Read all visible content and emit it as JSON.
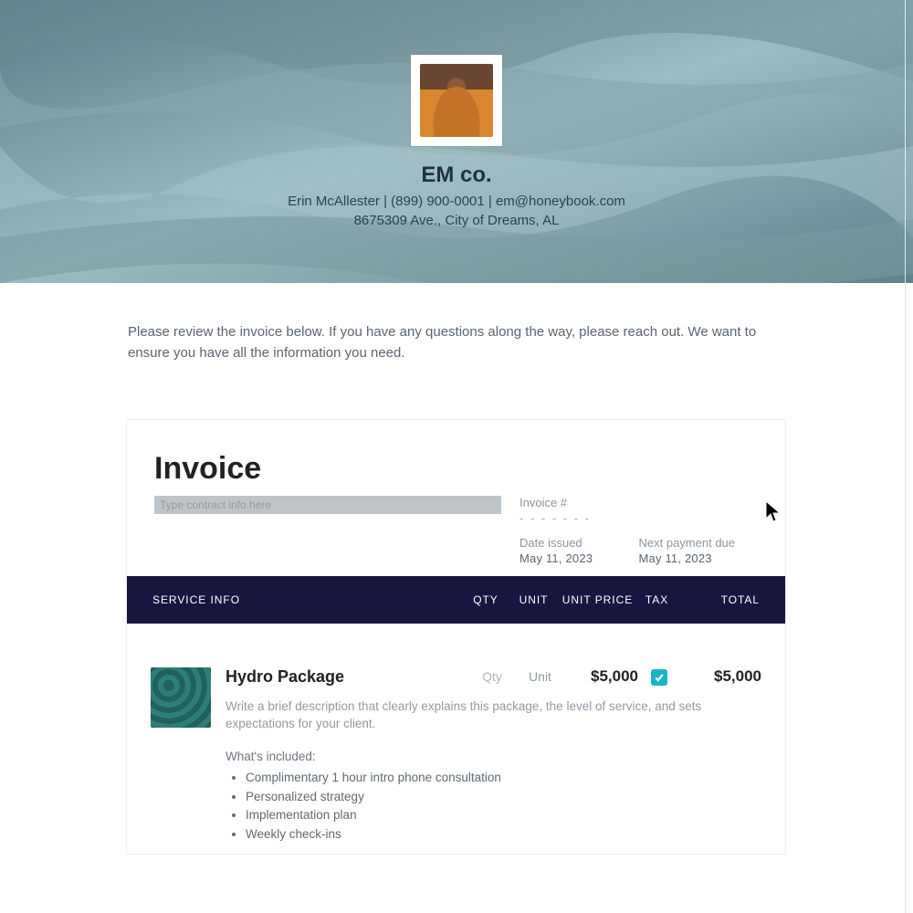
{
  "header": {
    "company": "EM co.",
    "contact_line": "Erin McAllester | (899) 900-0001 | em@honeybook.com",
    "address": "8675309 Ave., City of Dreams, AL"
  },
  "intro_text": "Please review the invoice below. If you have any questions along the way, please reach out. We want to ensure you have all the information you need.",
  "invoice": {
    "title": "Invoice",
    "contract_placeholder": "Type contract info here",
    "meta": {
      "invoice_num_label": "Invoice #",
      "invoice_num_value": "- - - - - - -",
      "date_issued_label": "Date issued",
      "date_issued_value": "May 11, 2023",
      "next_due_label": "Next payment due",
      "next_due_value": "May 11, 2023"
    },
    "columns": {
      "service": "SERVICE INFO",
      "qty": "QTY",
      "unit": "UNIT",
      "unit_price": "UNIT PRICE",
      "tax": "TAX",
      "total": "TOTAL"
    },
    "item": {
      "name": "Hydro Package",
      "qty_placeholder": "Qty",
      "unit_placeholder": "Unit",
      "unit_price": "$5,000",
      "tax_checked": true,
      "total": "$5,000",
      "description": "Write a brief description that clearly explains this package, the level of service, and sets expectations for your client.",
      "included_label": "What's included:",
      "included": [
        "Complimentary 1 hour intro phone consultation",
        "Personalized strategy",
        "Implementation plan",
        "Weekly check-ins"
      ]
    }
  },
  "colors": {
    "header_bar": "#17163f",
    "accent_check": "#19b4c5"
  }
}
